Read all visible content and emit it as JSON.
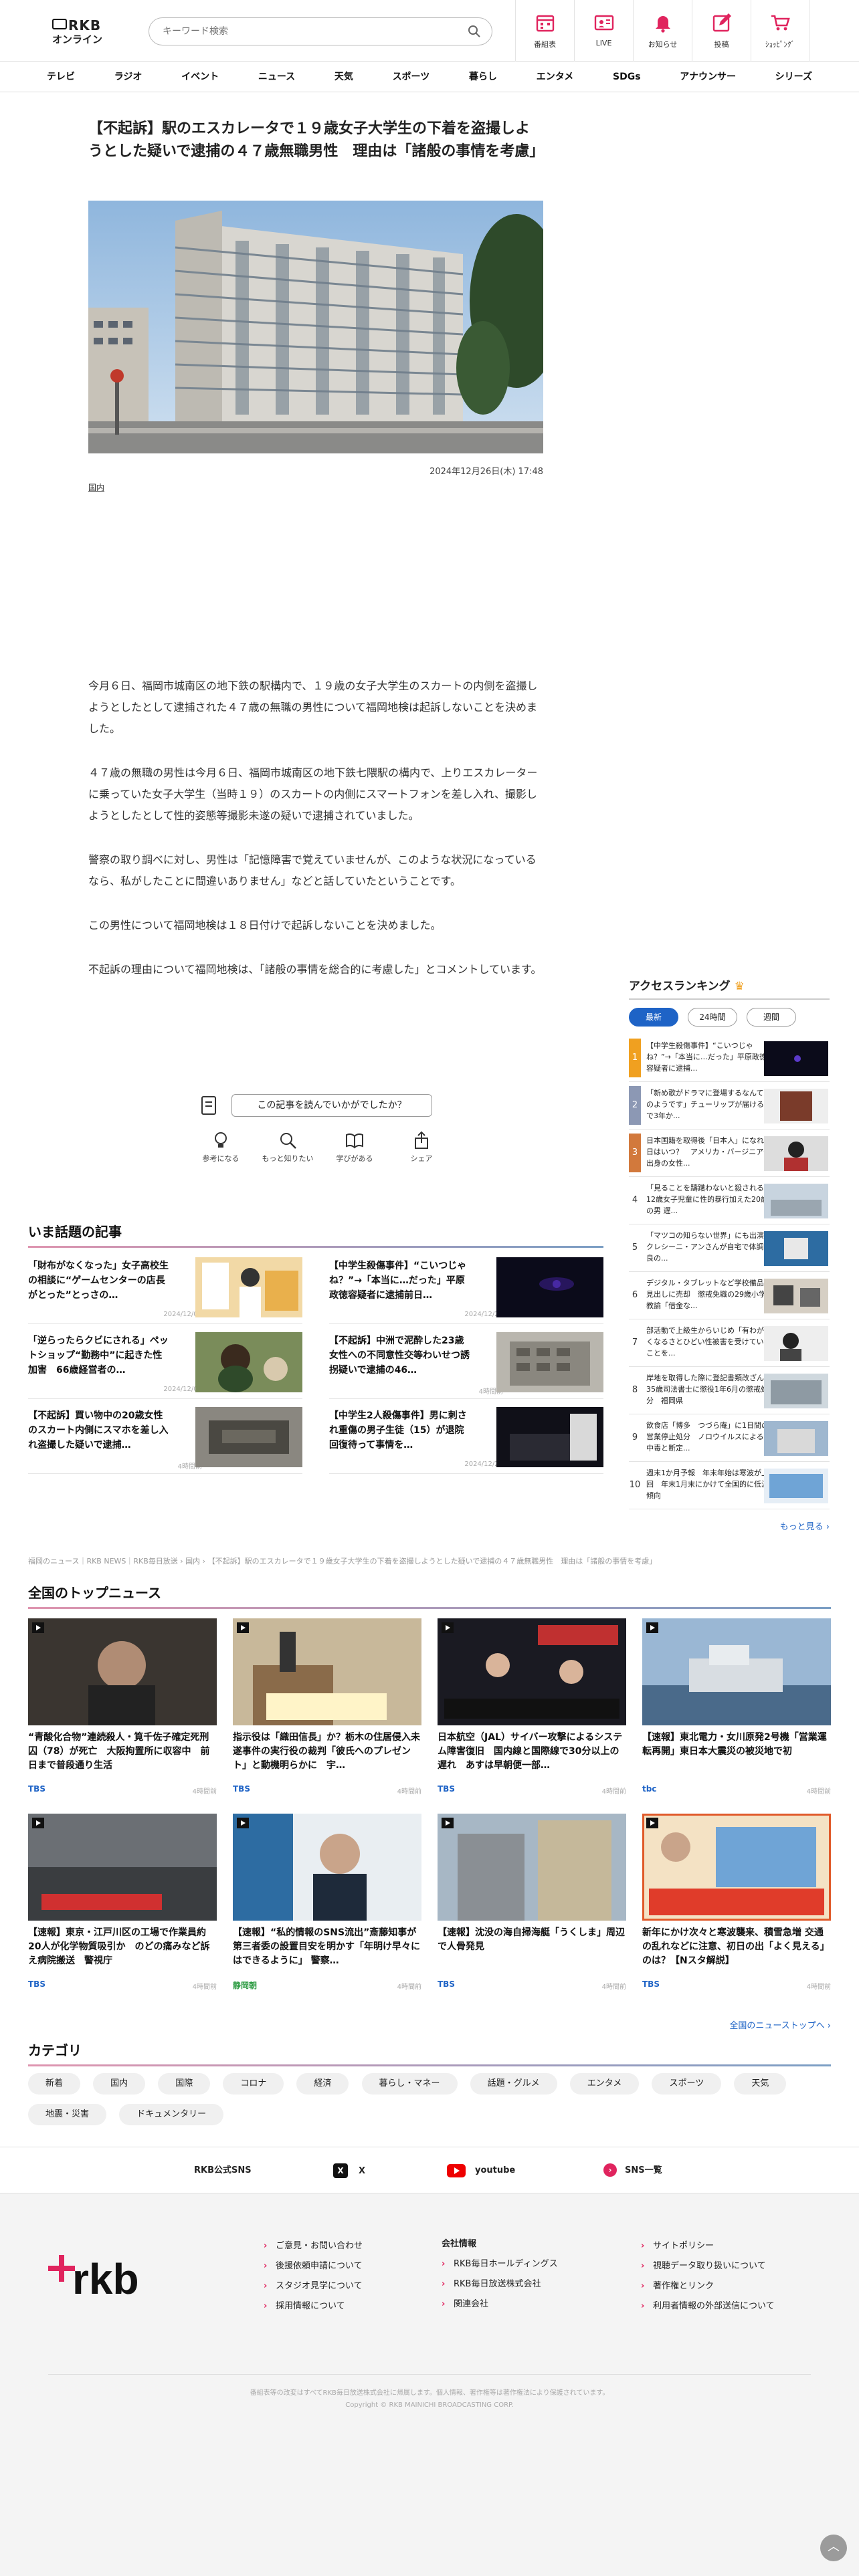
{
  "header": {
    "logo_line1": "RKB",
    "logo_line2": "オンライン",
    "search_placeholder": "キーワード検索",
    "nav_icons": [
      {
        "label": "番組表",
        "icon": "calendar-icon"
      },
      {
        "label": "LIVE",
        "icon": "live-icon"
      },
      {
        "label": "お知らせ",
        "icon": "bell-icon"
      },
      {
        "label": "投稿",
        "icon": "post-icon"
      },
      {
        "label": "ｼｮｯﾋﾟﾝｸﾞ",
        "icon": "cart-icon"
      }
    ],
    "categories": [
      "テレビ",
      "ラジオ",
      "イベント",
      "ニュース",
      "天気",
      "スポーツ",
      "暮らし",
      "エンタメ",
      "SDGs",
      "アナウンサー",
      "シリーズ"
    ],
    "accent": "#e0245e"
  },
  "article": {
    "title": "【不起訴】駅のエスカレータで１９歳女子大学生の下着を盗撮しようとした疑いで逮捕の４７歳無職男性　理由は「諸般の事情を考慮」",
    "date": "2024年12月26日(木) 17:48",
    "genre": "国内",
    "paragraphs": [
      "今月６日、福岡市城南区の地下鉄の駅構内で、１９歳の女子大学生のスカートの内側を盗撮しようとしたとして逮捕された４７歳の無職の男性について福岡地検は起訴しないことを決めました。",
      "４７歳の無職の男性は今月６日、福岡市城南区の地下鉄七隈駅の構内で、上りエスカレーターに乗っていた女子大学生（当時１９）のスカートの内側にスマートフォンを差し入れ、撮影しようとしたとして性的姿態等撮影未遂の疑いで逮捕されていました。",
      "警察の取り調べに対し、男性は「記憶障害で覚えていませんが、このような状況になっているなら、私がしたことに間違いありません」などと話していたということです。",
      "この男性について福岡地検は１８日付けで起訴しないことを決めました。",
      "不起訴の理由について福岡地検は、「諸般の事情を総合的に考慮した」とコメントしています。"
    ],
    "feedback_question": "この記事を読んでいかがでしたか？",
    "reactions": [
      {
        "label": "参考になる",
        "icon": "lightbulb-icon"
      },
      {
        "label": "もっと知りたい",
        "icon": "magnifier-icon"
      },
      {
        "label": "学びがある",
        "icon": "book-icon"
      },
      {
        "label": "シェア",
        "icon": "share-icon"
      }
    ]
  },
  "trending": {
    "title": "いま話題の記事",
    "items": [
      {
        "title": "「財布がなくなった」女子高校生の相談に“ゲームセンターの店長がとった”とっさの…",
        "date": "2024/12/07"
      },
      {
        "title": "【中学生殺傷事件】“こいつじゃね？”→「本当に…だった」平原政徳容疑者に逮捕前日…",
        "date": "2024/12/22"
      },
      {
        "title": "「逆らったらクビにされる」ペットショップ“勤務中”に起きた性加害　66歳経営者の…",
        "date": "2024/12/07"
      },
      {
        "title": "【不起訴】中洲で泥酔した23歳女性への不同意性交等わいせつ誘拐疑いで逮捕の46…",
        "date": "4時間前"
      },
      {
        "title": "【不起訴】買い物中の20歳女性のスカート内側にスマホを差し入れ盗撮した疑いで逮捕…",
        "date": "4時間前"
      },
      {
        "title": "【中学生2人殺傷事件】男に刺され重傷の男子生徒（15）が退院　回復待って事情を…",
        "date": "2024/12/26"
      }
    ]
  },
  "ranking": {
    "title": "アクセスランキング",
    "tabs": [
      "最新",
      "24時間",
      "週間"
    ],
    "items": [
      {
        "num": "1",
        "title": "【中学生殺傷事件】“こいつじゃね？”→「本当に…だった」平原政徳容疑者に逮捕..."
      },
      {
        "num": "2",
        "title": "「新め歌がドラマに登場するなんて夢のようです」チューリップが届けるまで3年か..."
      },
      {
        "num": "3",
        "title": "日本国籍を取得後「日本人」になれる日はいつ？　アメリカ・バージニア州出身の女性..."
      },
      {
        "num": "4",
        "title": "「見ることを躊躇わないと殺される」12歳女子児童に性的暴行加えた20歳の男 遅..."
      },
      {
        "num": "5",
        "title": "「マツコの知らない世界」にも出演　クレシーニ・アンさんが自宅で体調不良の..."
      },
      {
        "num": "6",
        "title": "デジタル・タブレットなど学校備品を見出しに売却　懲戒免職の29歳小学校教諭「借金な..."
      },
      {
        "num": "7",
        "title": "部活動で上級生からいじめ「有わがてくなるさとひどい性被害を受けていたことを..."
      },
      {
        "num": "8",
        "title": "岸地を取得した際に登記書類改ざん　35歳司法書士に懲役1年6月の懲戒処分　福岡県"
      },
      {
        "num": "9",
        "title": "飲食店「博多　つづら庵」に1日間の営業停止処分　ノロウイルスによる食中毒と断定..."
      },
      {
        "num": "10",
        "title": "週末1か月予報　年末年始は寒波が上回　年末1月末にかけて全国的に低温傾向"
      }
    ],
    "more": "もっと見る ›"
  },
  "breadcrumb": "福岡のニュース｜RKB NEWS｜RKB毎日放送 › 国内 › 【不起訴】駅のエスカレータで１９歳女子大学生の下着を盗撮しようとした疑いで逮捕の４７歳無職男性　理由は「諸般の事情を考慮」",
  "national": {
    "title": "全国のトップニュース",
    "items": [
      {
        "title": "“青酸化合物”連続殺人・筧千佐子確定死刑囚（78）が死亡　大阪拘置所に収容中　前日まで普段通り生活",
        "source": "TBS",
        "ago": "4時間前"
      },
      {
        "title": "指示役は「織田信長」か？栃木の住居侵入未遂事件の実行役の裁判「彼氏へのプレゼント」と動機明らかに　宇…",
        "source": "TBS",
        "ago": "4時間前"
      },
      {
        "title": "日本航空（JAL）サイバー攻撃によるシステム障害復旧　国内線と国際線で30分以上の遅れ　あすは早朝便一部…",
        "source": "TBS",
        "ago": "4時間前"
      },
      {
        "title": "【速報】東北電力・女川原発2号機「営業運転再開」東日本大震災の被災地で初",
        "source": "tbc",
        "ago": "4時間前"
      },
      {
        "title": "【速報】東京・江戸川区の工場で作業員約20人が化学物質吸引か　のどの痛みなど訴え病院搬送　警視庁",
        "source": "TBS",
        "ago": "4時間前"
      },
      {
        "title": "【速報】“私的情報のSNS流出”斎藤知事が第三者委の設置目安を明かす「年明け早々にはできるように」 警察…",
        "source": "静岡朝",
        "ago": "4時間前"
      },
      {
        "title": "【速報】沈没の海自掃海艇「うくしま」周辺で人骨発見",
        "source": "TBS",
        "ago": "4時間前"
      },
      {
        "title": "新年にかけ次々と寒波襲来、積雪急増 交通の乱れなどに注意、初日の出「よく見える」のは？【Nスタ解説】",
        "source": "TBS",
        "ago": "4時間前"
      }
    ],
    "more": "全国のニューストップへ ›"
  },
  "category": {
    "title": "カテゴリ",
    "items": [
      "新着",
      "国内",
      "国際",
      "コロナ",
      "経済",
      "暮らし・マネー",
      "話題・グルメ",
      "エンタメ",
      "スポーツ",
      "天気",
      "地震・災害",
      "ドキュメンタリー"
    ]
  },
  "sns": {
    "label": "RKB公式SNS",
    "items": [
      {
        "label": "X",
        "icon": "x-icon"
      },
      {
        "label": "youtube",
        "icon": "youtube-icon"
      },
      {
        "label": "SNS一覧",
        "icon": "sns-list-icon"
      }
    ]
  },
  "footer": {
    "col1": [
      "ご意見・お問い合わせ",
      "後援依頼申請について",
      "スタジオ見学について",
      "採用情報について"
    ],
    "col2_head": "会社情報",
    "col2": [
      "RKB毎日ホールディングス",
      "RKB毎日放送株式会社",
      "関連会社"
    ],
    "col3": [
      "サイトポリシー",
      "視聴データ取り扱いについて",
      "著作権とリンク",
      "利用者情報の外部送信について"
    ],
    "note1": "番組表等の改変はすべてRKB毎日放送株式会社に帰属します。個人情報、著作権等は著作権法により保護されています。",
    "note2": "Copyright © RKB MAINICHI BROADCASTING CORP."
  }
}
